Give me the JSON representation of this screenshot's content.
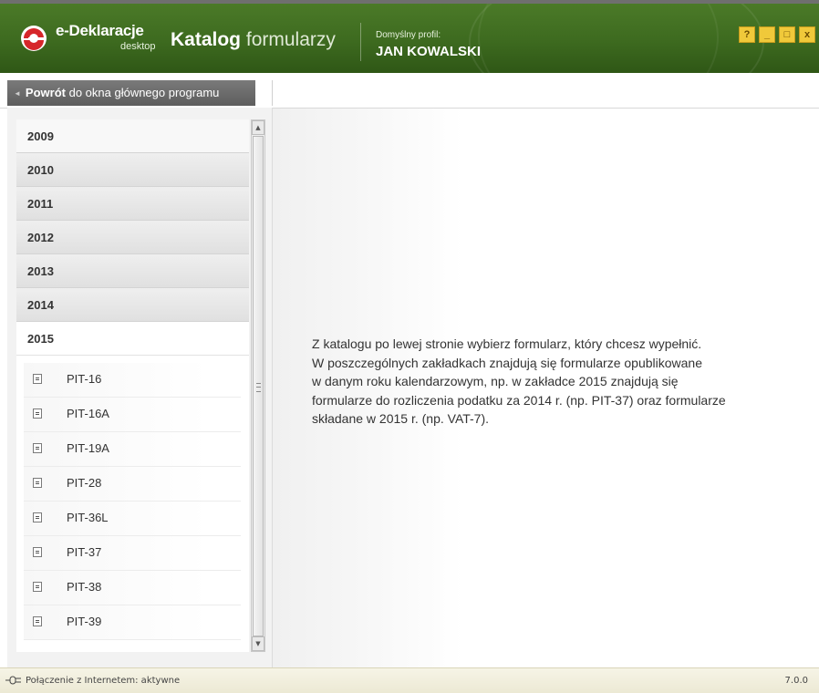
{
  "header": {
    "logo_text": "e-Deklaracje",
    "logo_sub": "desktop",
    "title_bold": "Katalog",
    "title_light": "formularzy",
    "profile_label": "Domyślny profil:",
    "profile_name": "JAN KOWALSKI",
    "window_buttons": [
      "?",
      "_",
      "□",
      "x"
    ]
  },
  "back": {
    "bold": "Powrót",
    "rest": " do okna głównego programu"
  },
  "catalog": {
    "years": [
      "2009",
      "2010",
      "2011",
      "2012",
      "2013",
      "2014",
      "2015"
    ],
    "open_year": "2015",
    "forms": [
      "PIT-16",
      "PIT-16A",
      "PIT-19A",
      "PIT-28",
      "PIT-36L",
      "PIT-37",
      "PIT-38",
      "PIT-39"
    ]
  },
  "info": {
    "lines": [
      "Z katalogu po lewej stronie wybierz formularz, który chcesz wypełnić.",
      "W poszczególnych zakładkach znajdują się formularze opublikowane",
      "w danym roku kalendarzowym, np. w zakładce 2015 znajdują się",
      "formularze do rozliczenia podatku za 2014 r. (np. PIT-37) oraz formularze",
      "składane w 2015 r. (np. VAT-7)."
    ]
  },
  "status": {
    "text": "Połączenie z Internetem: aktywne",
    "version": "7.0.0"
  },
  "colors": {
    "header_green": "#3d6a1f",
    "logo_red": "#d6262a",
    "button_yellow": "#f0c93a"
  }
}
